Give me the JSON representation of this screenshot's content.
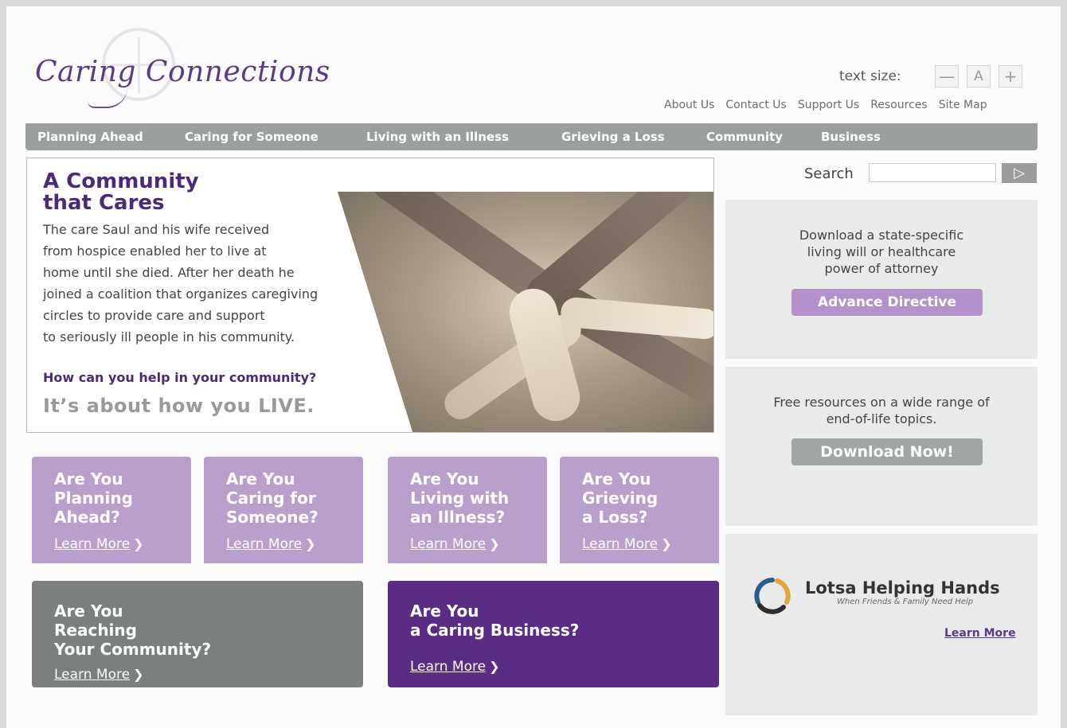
{
  "logo": {
    "text": "Caring Connections"
  },
  "text_size": {
    "label": "text size:",
    "decrease": "—",
    "normal": "A",
    "increase": "+"
  },
  "utility_links": [
    "About Us",
    "Contact Us",
    "Support Us",
    "Resources",
    "Site Map"
  ],
  "nav": [
    "Planning Ahead",
    "Caring for Someone",
    "Living with an Illness",
    "Grieving a Loss",
    "Community",
    "Business"
  ],
  "hero": {
    "title_line1": "A Community",
    "title_line2": "that Cares",
    "body": [
      "The care Saul and his wife received",
      "from hospice enabled her to live at",
      "home until she died. After her death he",
      "joined a coalition that organizes caregiving",
      "circles to provide care and support",
      "to seriously ill people in his community."
    ],
    "question": "How can you help in your community?",
    "tagline": "It’s about how you LIVE."
  },
  "tiles": [
    {
      "lines": [
        "Are You",
        "Planning",
        "Ahead?"
      ],
      "link": "Learn More",
      "color": "#b9a0cc"
    },
    {
      "lines": [
        "Are You",
        "Caring for",
        "Someone?"
      ],
      "link": "Learn More",
      "color": "#b9a0cc"
    },
    {
      "lines": [
        "Are You",
        "Living with",
        "an Illness?"
      ],
      "link": "Learn More",
      "color": "#b9a0cc"
    },
    {
      "lines": [
        "Are You",
        "Grieving",
        "a Loss?"
      ],
      "link": "Learn More",
      "color": "#b9a0cc"
    },
    {
      "lines": [
        "Are You",
        "Reaching",
        "Your Community?"
      ],
      "link": "Learn More",
      "color": "#7b7f80"
    },
    {
      "lines": [
        "Are You",
        "a Caring Business?"
      ],
      "link": "Learn More",
      "color": "#5b2c84"
    }
  ],
  "search": {
    "label": "Search",
    "placeholder": "",
    "button_icon": "arrow-right-icon"
  },
  "sidebar": {
    "advance": {
      "lines": [
        "Download a state-specific",
        "living will or healthcare",
        "power of attorney"
      ],
      "button": "Advance Directive"
    },
    "download": {
      "lines": [
        "Free resources on a wide range of",
        "end-of-life topics."
      ],
      "button": "Download Now!"
    },
    "lotsa": {
      "title": "Lotsa Helping Hands",
      "subtitle": "When Friends & Family Need Help",
      "link": "Learn More"
    }
  },
  "colors": {
    "brand_purple": "#5b3a86",
    "tile_lavender": "#b9a0cc",
    "tile_gray": "#7b7f80",
    "tile_purple": "#5b2c84",
    "nav_gray": "#9c9fa0"
  }
}
